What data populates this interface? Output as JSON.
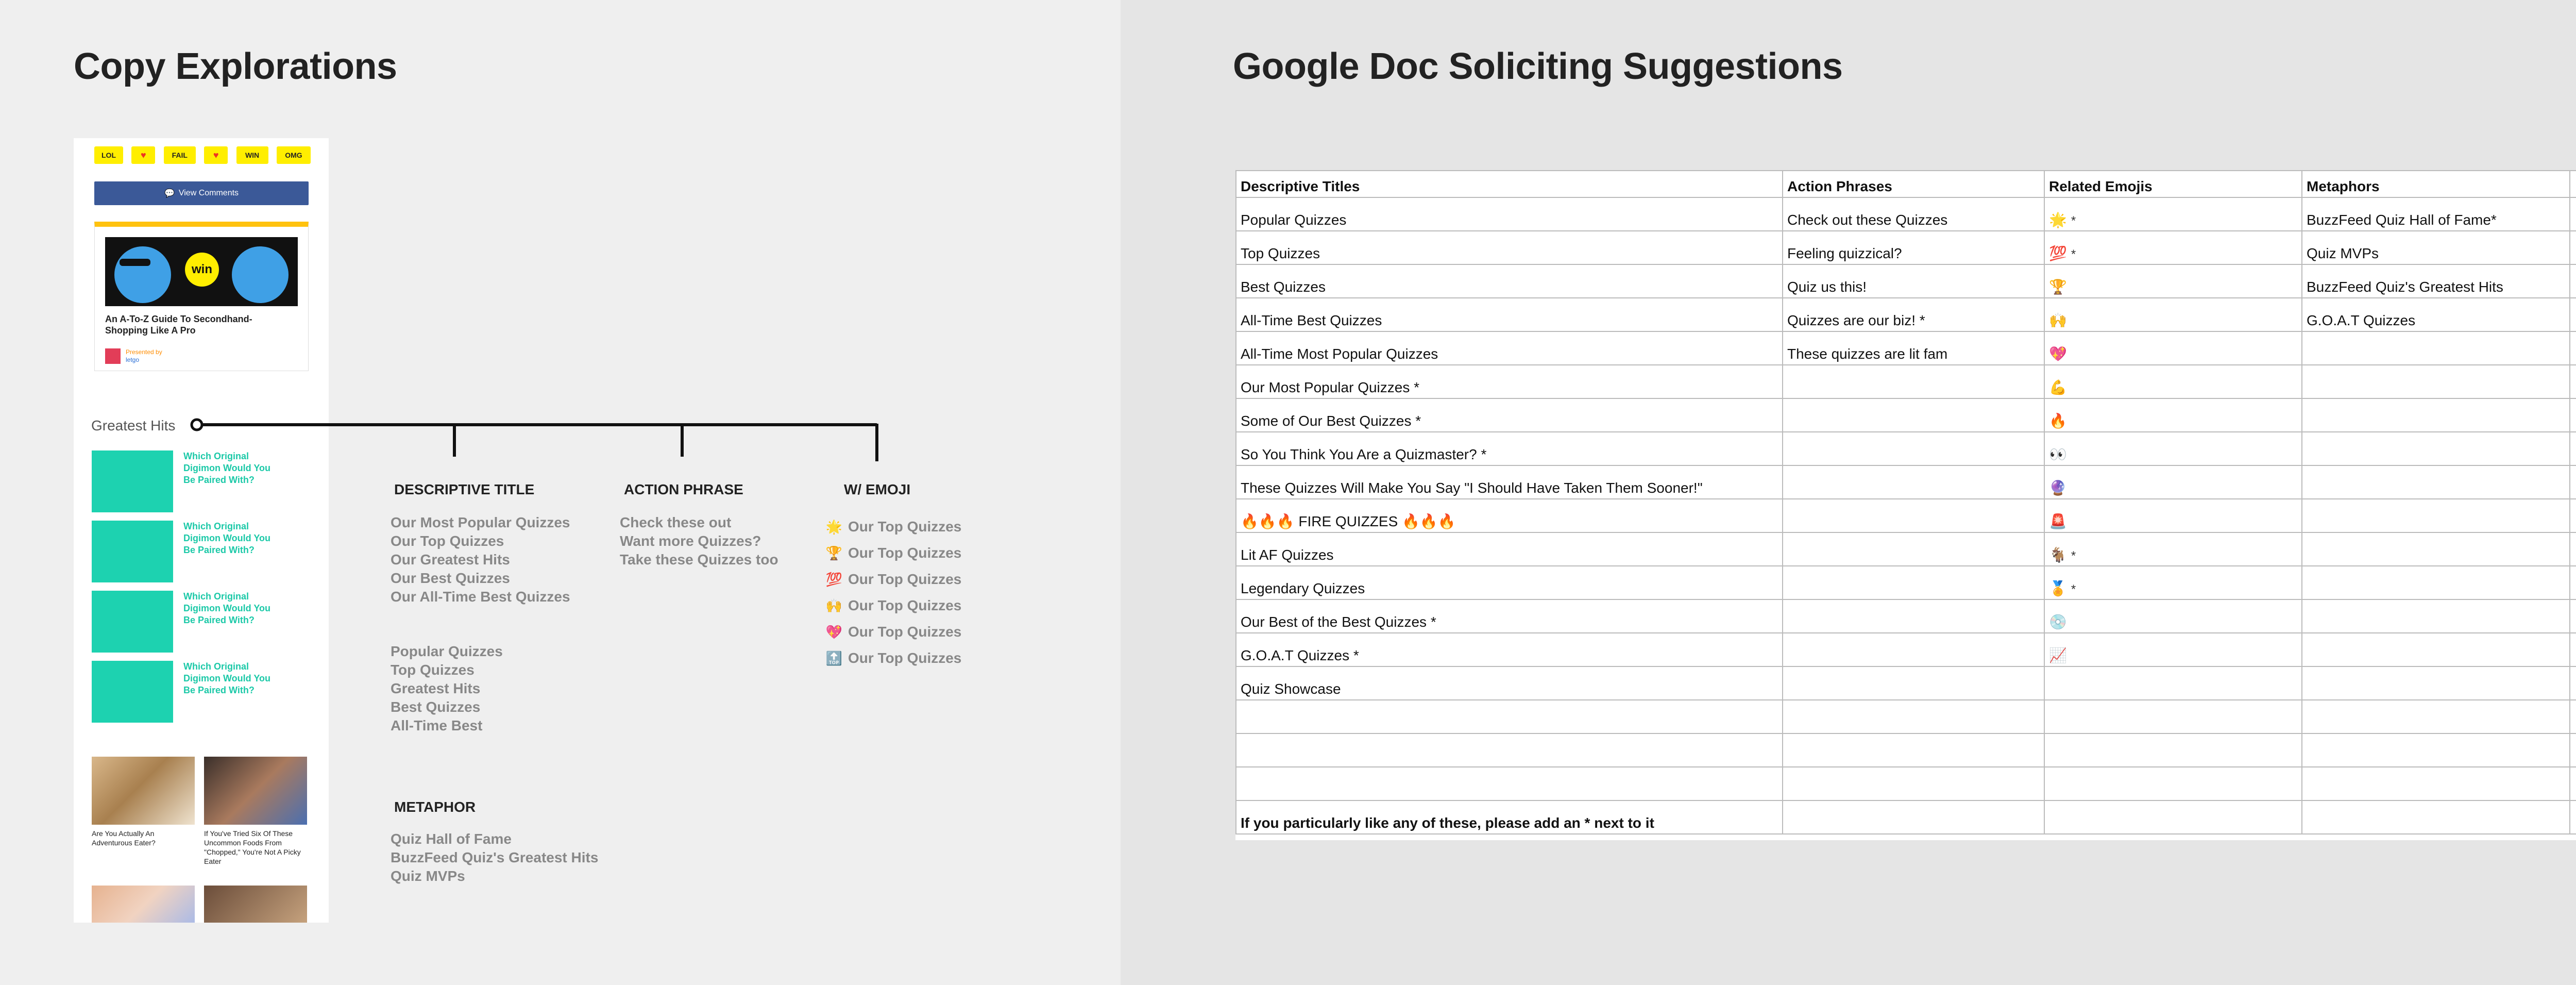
{
  "left": {
    "title": "Copy Explorations",
    "phone": {
      "reactions": [
        "LOL",
        "♥",
        "FAIL",
        "♥",
        "WIN",
        "OMG"
      ],
      "view_comments": "View Comments",
      "card": {
        "title": "An A-To-Z Guide To Secondhand-Shopping Like A Pro",
        "badge": "win",
        "presented_by": "Presented by",
        "sponsor": "letgo"
      },
      "greatest_hits_label": "Greatest Hits",
      "quiz_items": [
        "Which Original Digimon Would You Be Paired With?",
        "Which Original Digimon Would You Be Paired With?",
        "Which Original Digimon Would You Be Paired With?",
        "Which Original Digimon Would You Be Paired With?"
      ],
      "photo_captions": [
        "Are You Actually An Adventurous Eater?",
        "If You've Tried Six Of These Uncommon Foods From \"Chopped,\" You're Not A Picky Eater"
      ]
    },
    "descriptive": {
      "heading": "DESCRIPTIVE TITLE",
      "group1": [
        "Our Most Popular Quizzes",
        "Our Top Quizzes",
        "Our Greatest Hits",
        "Our Best Quizzes",
        "Our All-Time Best Quizzes"
      ],
      "group2": [
        "Popular Quizzes",
        "Top Quizzes",
        "Greatest Hits",
        "Best Quizzes",
        "All-Time Best"
      ]
    },
    "action": {
      "heading": "ACTION PHRASE",
      "items": [
        "Check these out",
        "Want more Quizzes?",
        "Take these Quizzes too"
      ]
    },
    "emoji": {
      "heading": "W/ EMOJI",
      "items": [
        {
          "icon": "🌟",
          "text": "Our Top Quizzes"
        },
        {
          "icon": "🏆",
          "text": "Our Top Quizzes"
        },
        {
          "icon": "💯",
          "text": "Our Top Quizzes"
        },
        {
          "icon": "🙌",
          "text": "Our Top Quizzes"
        },
        {
          "icon": "💖",
          "text": "Our Top Quizzes"
        },
        {
          "icon": "🔝",
          "text": "Our Top Quizzes"
        }
      ]
    },
    "metaphor": {
      "heading": "METAPHOR",
      "items": [
        "Quiz Hall of Fame",
        "BuzzFeed Quiz's Greatest Hits",
        "Quiz MVPs"
      ]
    }
  },
  "right": {
    "title": "Google Doc Soliciting Suggestions",
    "sheet": {
      "headers": [
        "Descriptive Titles",
        "Action Phrases",
        "Related Emojis",
        "Metaphors"
      ],
      "rows": [
        [
          "Popular Quizzes",
          "Check out these Quizzes",
          "🌟",
          "*",
          "BuzzFeed Quiz Hall of Fame*"
        ],
        [
          "Top Quizzes",
          "Feeling quizzical?",
          "💯",
          "*",
          "Quiz MVPs"
        ],
        [
          "Best Quizzes",
          "Quiz us this!",
          "🏆",
          "",
          "BuzzFeed Quiz's Greatest Hits"
        ],
        [
          "All-Time Best Quizzes",
          "Quizzes are our biz! *",
          "🙌",
          "",
          "G.O.A.T Quizzes"
        ],
        [
          "All-Time Most Popular Quizzes",
          "These quizzes are lit fam",
          "💖",
          "",
          ""
        ],
        [
          "Our Most Popular Quizzes *",
          "",
          "💪",
          "",
          ""
        ],
        [
          "Some of Our Best Quizzes *",
          "",
          "🔥",
          "",
          ""
        ],
        [
          "So You Think You Are a Quizmaster? *",
          "",
          "👀",
          "",
          ""
        ],
        [
          "These Quizzes Will Make You Say \"I Should Have Taken Them Sooner!\"",
          "",
          "🔮",
          "",
          ""
        ],
        [
          "🔥🔥🔥 FIRE QUIZZES 🔥🔥🔥",
          "",
          "🚨",
          "",
          ""
        ],
        [
          "Lit AF Quizzes",
          "",
          "🐐",
          "*",
          ""
        ],
        [
          "Legendary Quizzes",
          "",
          "🏅",
          "*",
          ""
        ],
        [
          "Our Best of the Best Quizzes *",
          "",
          "💿",
          "",
          ""
        ],
        [
          "G.O.A.T Quizzes *",
          "",
          "📈",
          "",
          ""
        ],
        [
          "Quiz Showcase",
          "",
          "",
          "",
          ""
        ],
        [
          "",
          "",
          "",
          "",
          ""
        ],
        [
          "",
          "",
          "",
          "",
          ""
        ],
        [
          "",
          "",
          "",
          "",
          ""
        ]
      ],
      "note": "If you particularly like any of these, please add an * next to it"
    }
  }
}
